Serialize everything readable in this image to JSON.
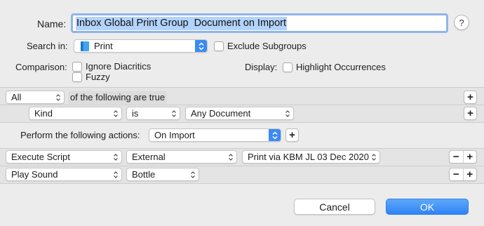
{
  "name": {
    "label": "Name:",
    "value": "Inbox Global Print Group  Document on Import"
  },
  "help_label": "?",
  "search": {
    "label": "Search in:",
    "value": "Print",
    "exclude_label": "Exclude Subgroups"
  },
  "comparison": {
    "label": "Comparison:",
    "ignore_diacritics": "Ignore Diacritics",
    "fuzzy": "Fuzzy"
  },
  "display": {
    "label": "Display:",
    "highlight": "Highlight Occurrences"
  },
  "conditions": {
    "match_value": "All",
    "of_following": "of the following are true",
    "criteria": [
      {
        "field": "Kind",
        "operator": "is",
        "value": "Any Document"
      }
    ]
  },
  "actions": {
    "label": "Perform the following actions:",
    "trigger": "On Import",
    "items": [
      {
        "action": "Execute Script",
        "type": "External",
        "target": "Print via KBM JL 03 Dec 2020"
      },
      {
        "action": "Play Sound",
        "type": "Bottle"
      }
    ]
  },
  "symbols": {
    "plus": "+",
    "minus": "−"
  },
  "buttons": {
    "cancel": "Cancel",
    "ok": "OK"
  },
  "colors": {
    "accent": "#2f84f4",
    "selection": "#b3d3fb",
    "focus_ring": "#8fb4ea"
  }
}
